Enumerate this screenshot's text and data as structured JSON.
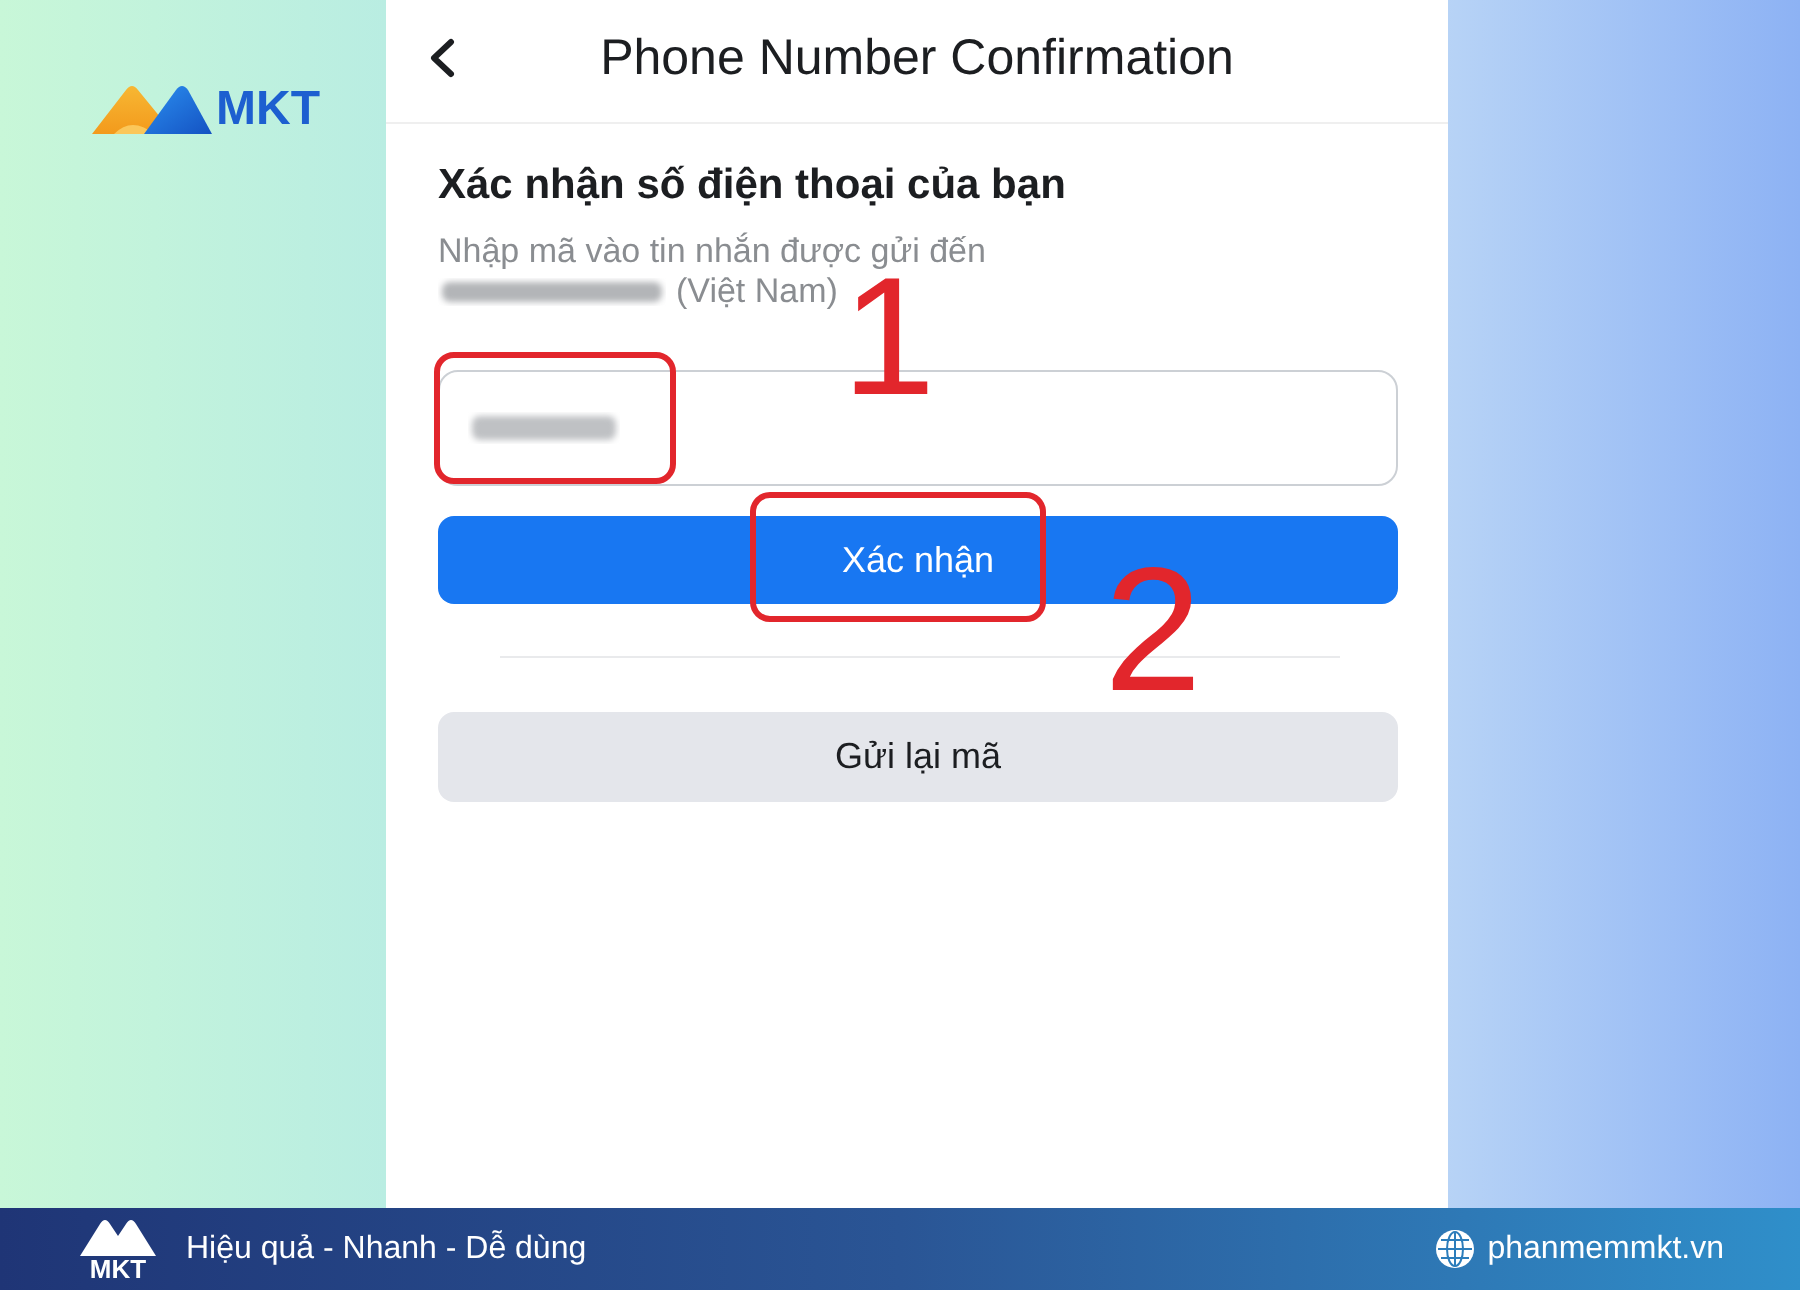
{
  "brand_logo": {
    "text": "MKT"
  },
  "header": {
    "title": "Phone Number Confirmation"
  },
  "confirmation": {
    "heading": "Xác nhận số điện thoại của bạn",
    "instructions": "Nhập mã vào tin nhắn được gửi đến",
    "phone_number": {
      "redacted": true
    },
    "region": "(Việt Nam)",
    "code_field": {
      "redacted": true
    }
  },
  "buttons": [
    {
      "label": "Xác nhận",
      "kind": "primary"
    },
    {
      "label": "Gửi lại mã",
      "kind": "secondary"
    }
  ],
  "annotations": [
    {
      "label": "1"
    },
    {
      "label": "2"
    }
  ],
  "footer": {
    "logo_text": "MKT",
    "slogan": "Hiệu quả - Nhanh - Dễ dùng",
    "website": "phanmemmkt.vn"
  }
}
